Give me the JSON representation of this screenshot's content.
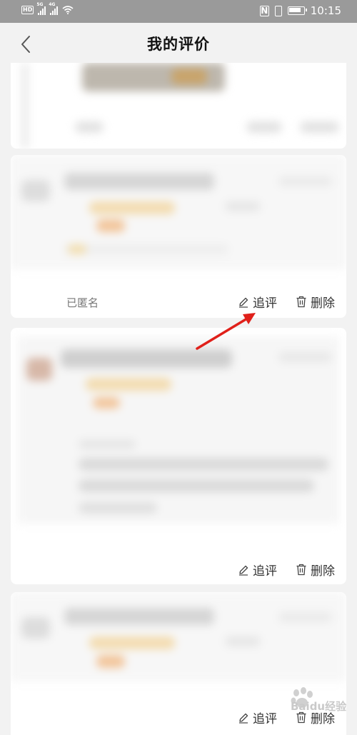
{
  "status_bar": {
    "left_badges": [
      "HD",
      "5G",
      "4G"
    ],
    "time": "10:15",
    "icons": [
      "nfc-icon",
      "vibrate-icon",
      "battery-icon"
    ]
  },
  "header": {
    "title": "我的评价",
    "back_icon": "chevron-left-icon"
  },
  "cards": [
    {
      "id": "card-0",
      "actions": []
    },
    {
      "id": "card-1",
      "anonymous": "已匿名",
      "follow_up": "追评",
      "delete": "删除"
    },
    {
      "id": "card-2",
      "follow_up": "追评",
      "delete": "删除"
    },
    {
      "id": "card-3",
      "follow_up": "追评",
      "delete": "删除"
    }
  ],
  "annotation": {
    "arrow_color": "#e0201a",
    "arrow_icon": "red-arrow"
  },
  "watermark": {
    "icon": "paw-icon",
    "text": "Baidu经验"
  }
}
